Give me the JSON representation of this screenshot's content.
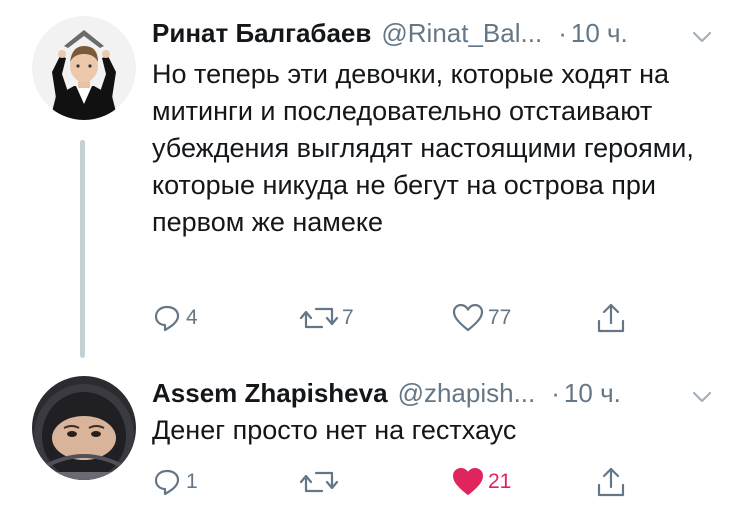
{
  "tweets": [
    {
      "name": "Ринат Балгабаев",
      "handle": "@Rinat_Bal...",
      "dot": "·",
      "time": "10 ч.",
      "text": "Но теперь эти девочки, которые ходят на митинги и последовательно отстаивают убеждения выглядят настоящими героями, которые никуда не бегут на острова при первом же намеке",
      "reply_count": "4",
      "retweet_count": "7",
      "like_count": "77",
      "liked": false
    },
    {
      "name": "Assem Zhapisheva",
      "handle": "@zhapish...",
      "dot": "·",
      "time": "10 ч.",
      "text": "Денег просто нет на гестхаус",
      "reply_count": "1",
      "retweet_count": "",
      "like_count": "21",
      "liked": true
    }
  ],
  "icons": {
    "reply": "reply-icon",
    "retweet": "retweet-icon",
    "like": "heart-icon",
    "share": "share-icon",
    "menu": "chevron-down-icon"
  },
  "colors": {
    "text": "#14171a",
    "muted": "#657786",
    "like": "#e0245e",
    "thread_line": "#c4cfd6"
  }
}
